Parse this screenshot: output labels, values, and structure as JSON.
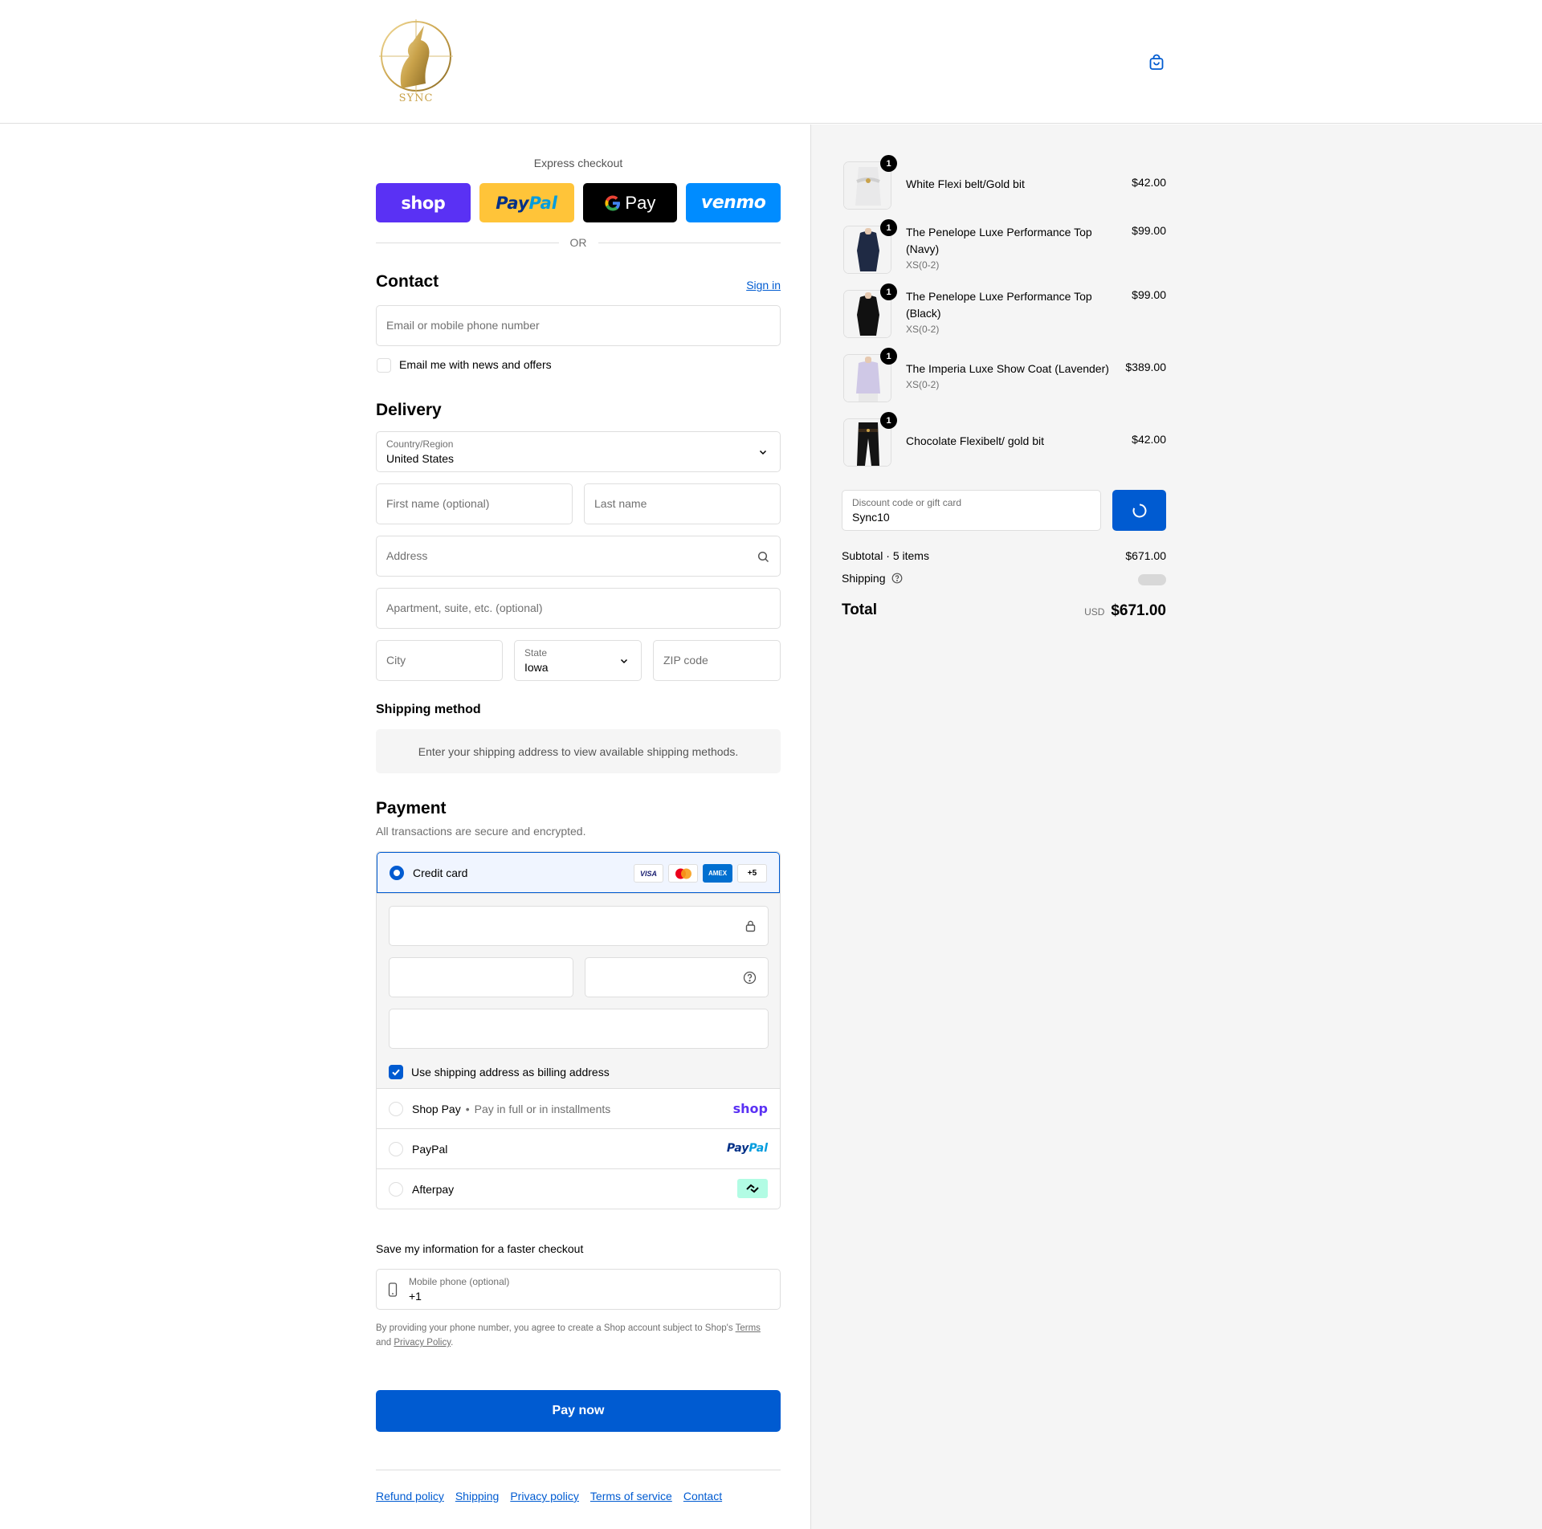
{
  "header": {
    "logo_text": "SYNC",
    "cart_icon": "bag-icon"
  },
  "express": {
    "title": "Express checkout",
    "buttons": {
      "shop": "shop",
      "paypal_a": "Pay",
      "paypal_b": "Pal",
      "gpay": "Pay",
      "venmo": "venmo"
    },
    "or": "OR"
  },
  "contact": {
    "title": "Contact",
    "sign_in": "Sign in",
    "email_placeholder": "Email or mobile phone number",
    "news_label": "Email me with news and offers"
  },
  "delivery": {
    "title": "Delivery",
    "country_label": "Country/Region",
    "country_value": "United States",
    "first_name": "First name (optional)",
    "last_name": "Last name",
    "address": "Address",
    "apartment": "Apartment, suite, etc. (optional)",
    "city": "City",
    "state_label": "State",
    "state_value": "Iowa",
    "zip": "ZIP code"
  },
  "shipping_method": {
    "title": "Shipping method",
    "message": "Enter your shipping address to view available shipping methods."
  },
  "payment": {
    "title": "Payment",
    "subtitle": "All transactions are secure and encrypted.",
    "credit_card": "Credit card",
    "cards": [
      "VISA",
      "",
      "AMEX",
      "+5"
    ],
    "billing_label": "Use shipping address as billing address",
    "shop_pay": "Shop Pay",
    "shop_pay_sub": "Pay in full or in installments",
    "shop_logo": "shop",
    "paypal": "PayPal",
    "paypal_logo_a": "Pay",
    "paypal_logo_b": "Pal",
    "afterpay": "Afterpay"
  },
  "save_info": {
    "title": "Save my information for a faster checkout",
    "phone_label": "Mobile phone (optional)",
    "phone_value": "+1",
    "disclaimer_a": "By providing your phone number, you agree to create a Shop account subject to Shop's ",
    "terms": "Terms",
    "disclaimer_b": "and ",
    "privacy": "Privacy Policy",
    "disclaimer_c": "."
  },
  "pay_now": "Pay now",
  "footer": [
    "Refund policy",
    "Shipping",
    "Privacy policy",
    "Terms of service",
    "Contact"
  ],
  "summary": {
    "items": [
      {
        "qty": "1",
        "name": "White Flexi belt/Gold bit",
        "variant": "",
        "price": "$42.00"
      },
      {
        "qty": "1",
        "name": "The Penelope Luxe Performance Top (Navy)",
        "variant": "XS(0-2)",
        "price": "$99.00"
      },
      {
        "qty": "1",
        "name": "The Penelope Luxe Performance Top (Black)",
        "variant": "XS(0-2)",
        "price": "$99.00"
      },
      {
        "qty": "1",
        "name": "The Imperia Luxe Show Coat (Lavender)",
        "variant": "XS(0-2)",
        "price": "$389.00"
      },
      {
        "qty": "1",
        "name": "Chocolate Flexibelt/ gold bit",
        "variant": "",
        "price": "$42.00"
      }
    ],
    "discount_label": "Discount code or gift card",
    "discount_value": "Sync10",
    "subtotal_label": "Subtotal · 5 items",
    "subtotal_value": "$671.00",
    "shipping_label": "Shipping",
    "total_label": "Total",
    "currency": "USD",
    "total_value": "$671.00"
  },
  "colors": {
    "accent": "#005bd1",
    "shop": "#5a31f4",
    "paypal": "#ffc439",
    "venmo": "#008cff"
  }
}
